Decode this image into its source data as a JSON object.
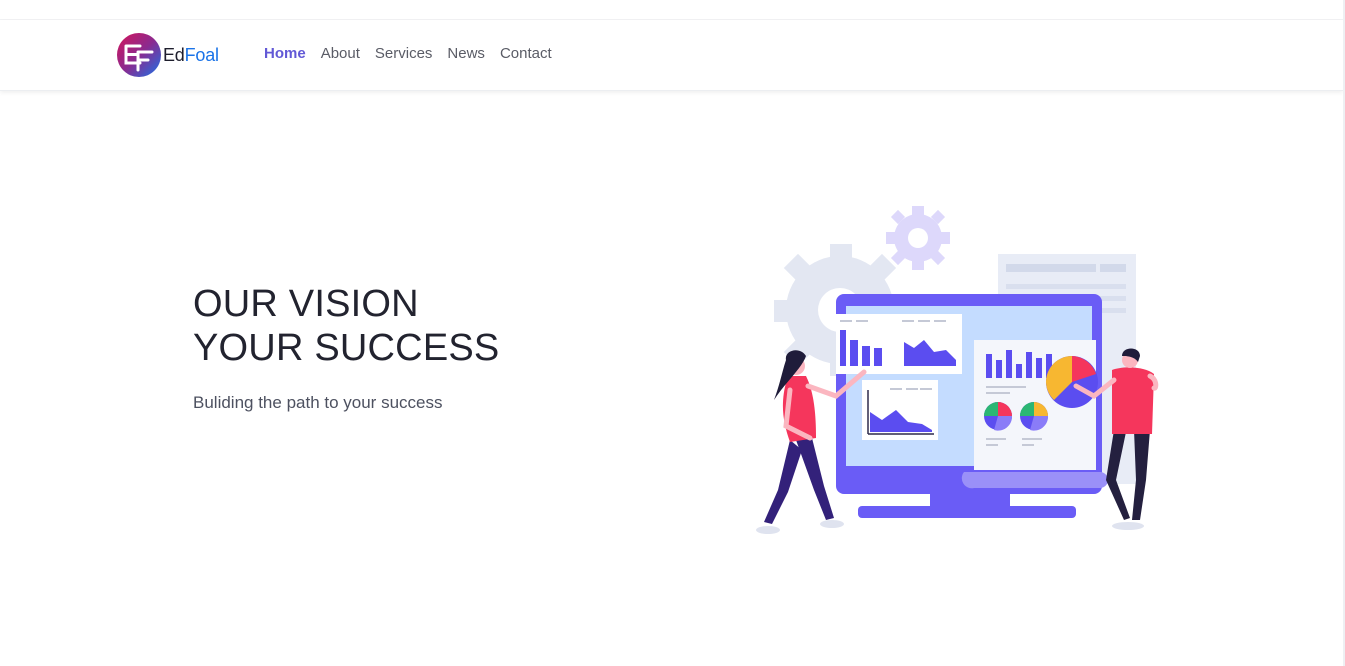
{
  "brand": {
    "part1": "Ed",
    "part2": "Foal",
    "logo_letters": "EF",
    "colors": {
      "part1": "#1e1e2d",
      "part2": "#1a73e8",
      "logo_from": "#d4145a",
      "logo_to": "#1a73e8"
    }
  },
  "nav": {
    "items": [
      {
        "label": "Home",
        "active": true
      },
      {
        "label": "About",
        "active": false
      },
      {
        "label": "Services",
        "active": false
      },
      {
        "label": "News",
        "active": false
      },
      {
        "label": "Contact",
        "active": false
      }
    ],
    "active_color": "#6259d6"
  },
  "hero": {
    "title_line1": "OUR VISION",
    "title_line2": "YOUR SUCCESS",
    "subtitle": "Buliding the path to your success"
  },
  "illustration": {
    "icon": "data-analytics-illustration",
    "colors": {
      "primary": "#6a5cf6",
      "accent": "#f5365c",
      "screen": "#c4dcff",
      "gear": "#dfe3ef"
    }
  }
}
